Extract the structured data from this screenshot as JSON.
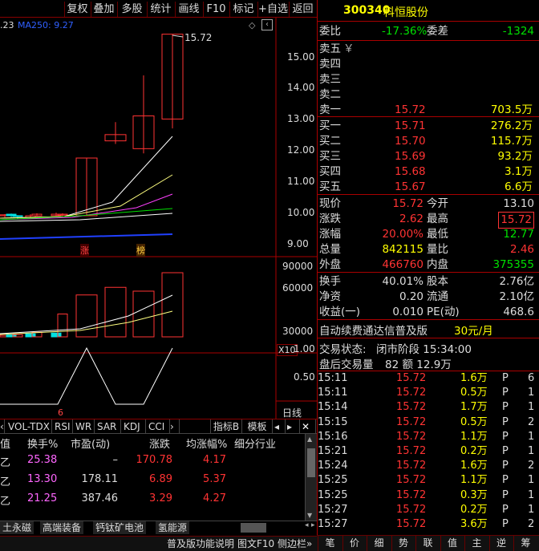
{
  "toolbar": {
    "buttons": [
      "复权",
      "叠加",
      "多股",
      "统计",
      "画线",
      "F10",
      "标记",
      "+自选",
      "返回"
    ]
  },
  "chart": {
    "ma_label_left": ".23",
    "ma250_label": "MA250: 9.27",
    "max_price_label": "15.72",
    "price_axis": [
      "15.00",
      "14.00",
      "13.00",
      "12.00",
      "11.00",
      "10.00",
      "9.00"
    ],
    "vol_axis": [
      "90000",
      "60000",
      "30000"
    ],
    "vol_unit": "X10",
    "ind_axis": [
      "1.00",
      "0.50"
    ],
    "badge_zhang": "涨",
    "badge_bang": "榜",
    "ind_marker": "6",
    "period_label": "日线"
  },
  "chart_data": [
    {
      "type": "candlestick",
      "title": "",
      "series": [
        {
          "name": "candles",
          "values": [
            [
              9.9,
              9.93,
              9.85,
              9.95
            ],
            [
              9.95,
              9.9,
              9.85,
              9.97
            ],
            [
              9.9,
              9.88,
              9.8,
              9.92
            ],
            [
              9.85,
              9.9,
              9.8,
              9.95
            ],
            [
              9.9,
              9.95,
              9.88,
              9.98
            ],
            [
              9.9,
              9.95,
              9.85,
              10.0
            ],
            [
              9.92,
              9.95,
              9.88,
              9.98
            ],
            [
              9.9,
              11.75,
              9.9,
              11.75
            ],
            [
              12.3,
              12.5,
              12.2,
              12.9
            ],
            [
              12.05,
              13.1,
              11.9,
              14.4
            ],
            [
              13.0,
              15.72,
              12.7,
              15.72
            ]
          ]
        }
      ],
      "ylim": [
        8.8,
        16.2
      ]
    },
    {
      "type": "bar",
      "title": "",
      "series": [
        {
          "name": "volume",
          "values": [
            2000,
            2500,
            3000,
            4000,
            6000,
            5000,
            30000,
            55000,
            65000,
            60000,
            84200
          ]
        }
      ]
    }
  ],
  "header": {
    "code": "300340",
    "name": "科恒股份"
  },
  "webi": {
    "label": "委比",
    "value": "-17.36%",
    "diff_label": "委差",
    "diff": "-1324"
  },
  "sells": [
    {
      "label": "卖五",
      "price": "",
      "vol": "",
      "extra": "￥"
    },
    {
      "label": "卖四",
      "price": "",
      "vol": "",
      "extra": ""
    },
    {
      "label": "卖三",
      "price": "",
      "vol": "",
      "extra": ""
    },
    {
      "label": "卖二",
      "price": "",
      "vol": "",
      "extra": ""
    },
    {
      "label": "卖一",
      "price": "15.72",
      "vol": "703.5万",
      "extra": ""
    }
  ],
  "buys": [
    {
      "label": "买一",
      "price": "15.71",
      "vol": "276.2万"
    },
    {
      "label": "买二",
      "price": "15.70",
      "vol": "115.7万"
    },
    {
      "label": "买三",
      "price": "15.69",
      "vol": "93.2万"
    },
    {
      "label": "买四",
      "price": "15.68",
      "vol": "3.1万"
    },
    {
      "label": "买五",
      "price": "15.67",
      "vol": "6.6万"
    }
  ],
  "stats1": [
    {
      "l1": "现价",
      "v1": "15.72",
      "l2": "今开",
      "v2": "13.10"
    },
    {
      "l1": "涨跌",
      "v1": "2.62",
      "l2": "最高",
      "v2": "15.72"
    },
    {
      "l1": "涨幅",
      "v1": "20.00%",
      "l2": "最低",
      "v2": "12.77"
    },
    {
      "l1": "总量",
      "v1": "842115",
      "l2": "量比",
      "v2": "2.46"
    },
    {
      "l1": "外盘",
      "v1": "466760",
      "l2": "内盘",
      "v2": "375355"
    }
  ],
  "stats2": [
    {
      "l1": "换手",
      "v1": "40.01%",
      "l2": "股本",
      "v2": "2.76亿"
    },
    {
      "l1": "净资",
      "v1": "0.20",
      "l2": "流通",
      "v2": "2.10亿"
    },
    {
      "l1": "收益(一)",
      "v1": "0.010",
      "l2": "PE(动)",
      "v2": "468.6"
    }
  ],
  "promo": {
    "text": "自动续费通达信普及版",
    "price": "30元/月"
  },
  "status": {
    "line1_label": "交易状态:",
    "line1_value": "闭市阶段 15:34:00",
    "line2_label": "盘后交易量",
    "line2_value": "82 额 12.9万"
  },
  "ticks": [
    {
      "t": "15:11",
      "p": "15.72",
      "v": "1.6万",
      "s": "P",
      "n": "6"
    },
    {
      "t": "15:11",
      "p": "15.72",
      "v": "0.5万",
      "s": "P",
      "n": "1"
    },
    {
      "t": "15:14",
      "p": "15.72",
      "v": "1.7万",
      "s": "P",
      "n": "1"
    },
    {
      "t": "15:15",
      "p": "15.72",
      "v": "0.5万",
      "s": "P",
      "n": "2"
    },
    {
      "t": "15:16",
      "p": "15.72",
      "v": "1.1万",
      "s": "P",
      "n": "1"
    },
    {
      "t": "15:21",
      "p": "15.72",
      "v": "0.2万",
      "s": "P",
      "n": "1"
    },
    {
      "t": "15:24",
      "p": "15.72",
      "v": "1.6万",
      "s": "P",
      "n": "2"
    },
    {
      "t": "15:25",
      "p": "15.72",
      "v": "1.1万",
      "s": "P",
      "n": "1"
    },
    {
      "t": "15:25",
      "p": "15.72",
      "v": "0.3万",
      "s": "P",
      "n": "1"
    },
    {
      "t": "15:27",
      "p": "15.72",
      "v": "0.2万",
      "s": "P",
      "n": "1"
    },
    {
      "t": "15:27",
      "p": "15.72",
      "v": "3.6万",
      "s": "P",
      "n": "2"
    }
  ],
  "ind_tabs": [
    "VOL-TDX",
    "RSI",
    "WR",
    "SAR",
    "KDJ",
    "CCI"
  ],
  "ind_buttons": {
    "zhibiao": "指标B",
    "moban": "模板"
  },
  "table": {
    "headers": [
      "值",
      "换手%",
      "市盈(动)",
      "涨跌",
      "均涨幅%",
      "细分行业"
    ],
    "rows": [
      [
        "乙",
        "25.38",
        "–",
        "170.78",
        "4.17",
        ""
      ],
      [
        "乙",
        "13.30",
        "178.11",
        "6.89",
        "5.37",
        ""
      ],
      [
        "乙",
        "21.25",
        "387.46",
        "3.29",
        "4.27",
        ""
      ]
    ]
  },
  "sector_tabs": [
    "土永磁",
    "高端装备",
    "钙钛矿电池",
    "氢能源"
  ],
  "bottom_tabs": [
    "笔",
    "价",
    "细",
    "势",
    "联",
    "值",
    "主",
    "逆",
    "筹"
  ],
  "status_bar": {
    "left": "普及版功能说明",
    "right": "图文F10 侧边栏»"
  }
}
